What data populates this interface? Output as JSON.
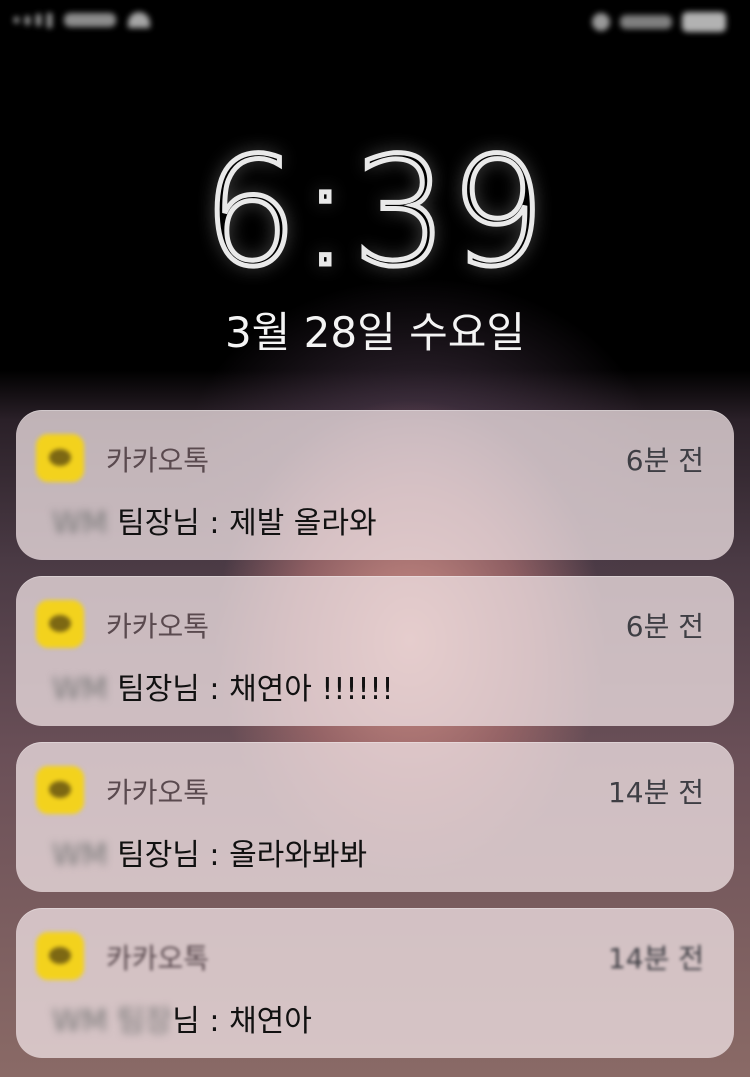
{
  "status_bar": {
    "carrier": "SKT",
    "battery": "100%"
  },
  "lock_screen": {
    "time": "6:39",
    "date": "3월 28일 수요일"
  },
  "notifications": [
    {
      "app": "카카오톡",
      "time_ago": "6분 전",
      "sender_blurred": "WM",
      "message": "팀장님 : 제발 올라와"
    },
    {
      "app": "카카오톡",
      "time_ago": "6분 전",
      "sender_blurred": "WM",
      "message": "팀장님 : 채연아 !!!!!!"
    },
    {
      "app": "카카오톡",
      "time_ago": "14분 전",
      "sender_blurred": "WM",
      "message": "팀장님 : 올라와봐봐"
    },
    {
      "app": "카카오톡",
      "time_ago": "14분 전",
      "sender_blurred": "WM 팀장",
      "message": "님 : 채연아"
    }
  ],
  "colors": {
    "kakao_yellow": "#f3d21d",
    "notification_bg": "#ecdee0"
  }
}
